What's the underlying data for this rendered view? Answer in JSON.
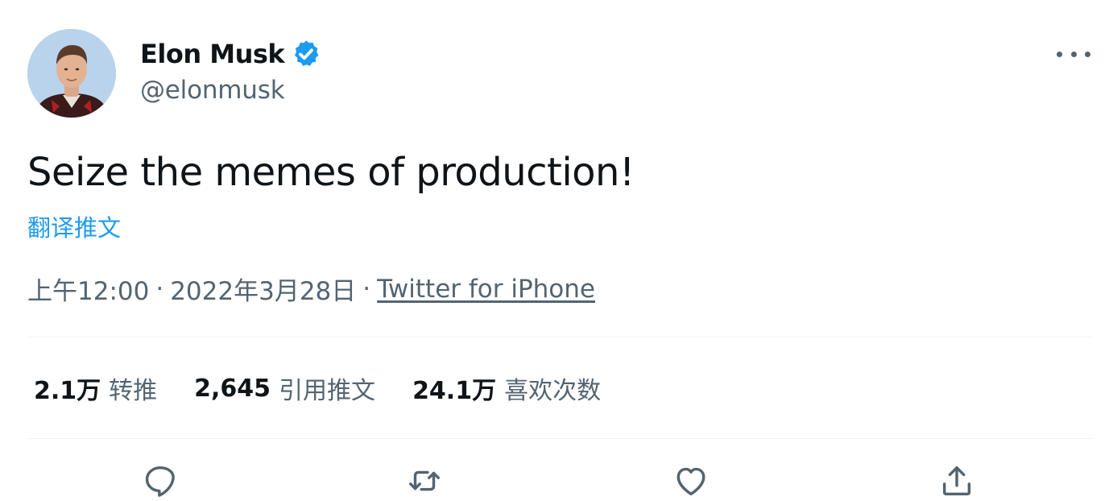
{
  "author": {
    "display_name": "Elon Musk",
    "handle": "@elonmusk",
    "verified": true,
    "avatar_icon": "profile-photo"
  },
  "tweet": {
    "text": "Seize the memes of production!",
    "translate_label": "翻译推文",
    "time": "上午12:00",
    "date": "2022年3月28日",
    "separator": "·",
    "source": "Twitter for iPhone"
  },
  "stats": [
    {
      "value": "2.1万",
      "label": "转推"
    },
    {
      "value": "2,645",
      "label": "引用推文"
    },
    {
      "value": "24.1万",
      "label": "喜欢次数"
    }
  ],
  "actions": {
    "reply_icon": "reply-icon",
    "retweet_icon": "retweet-icon",
    "like_icon": "like-icon",
    "share_icon": "share-icon"
  },
  "colors": {
    "accent": "#1d9bf0",
    "text_primary": "#0f1419",
    "text_secondary": "#536471",
    "divider": "#eff3f4"
  }
}
